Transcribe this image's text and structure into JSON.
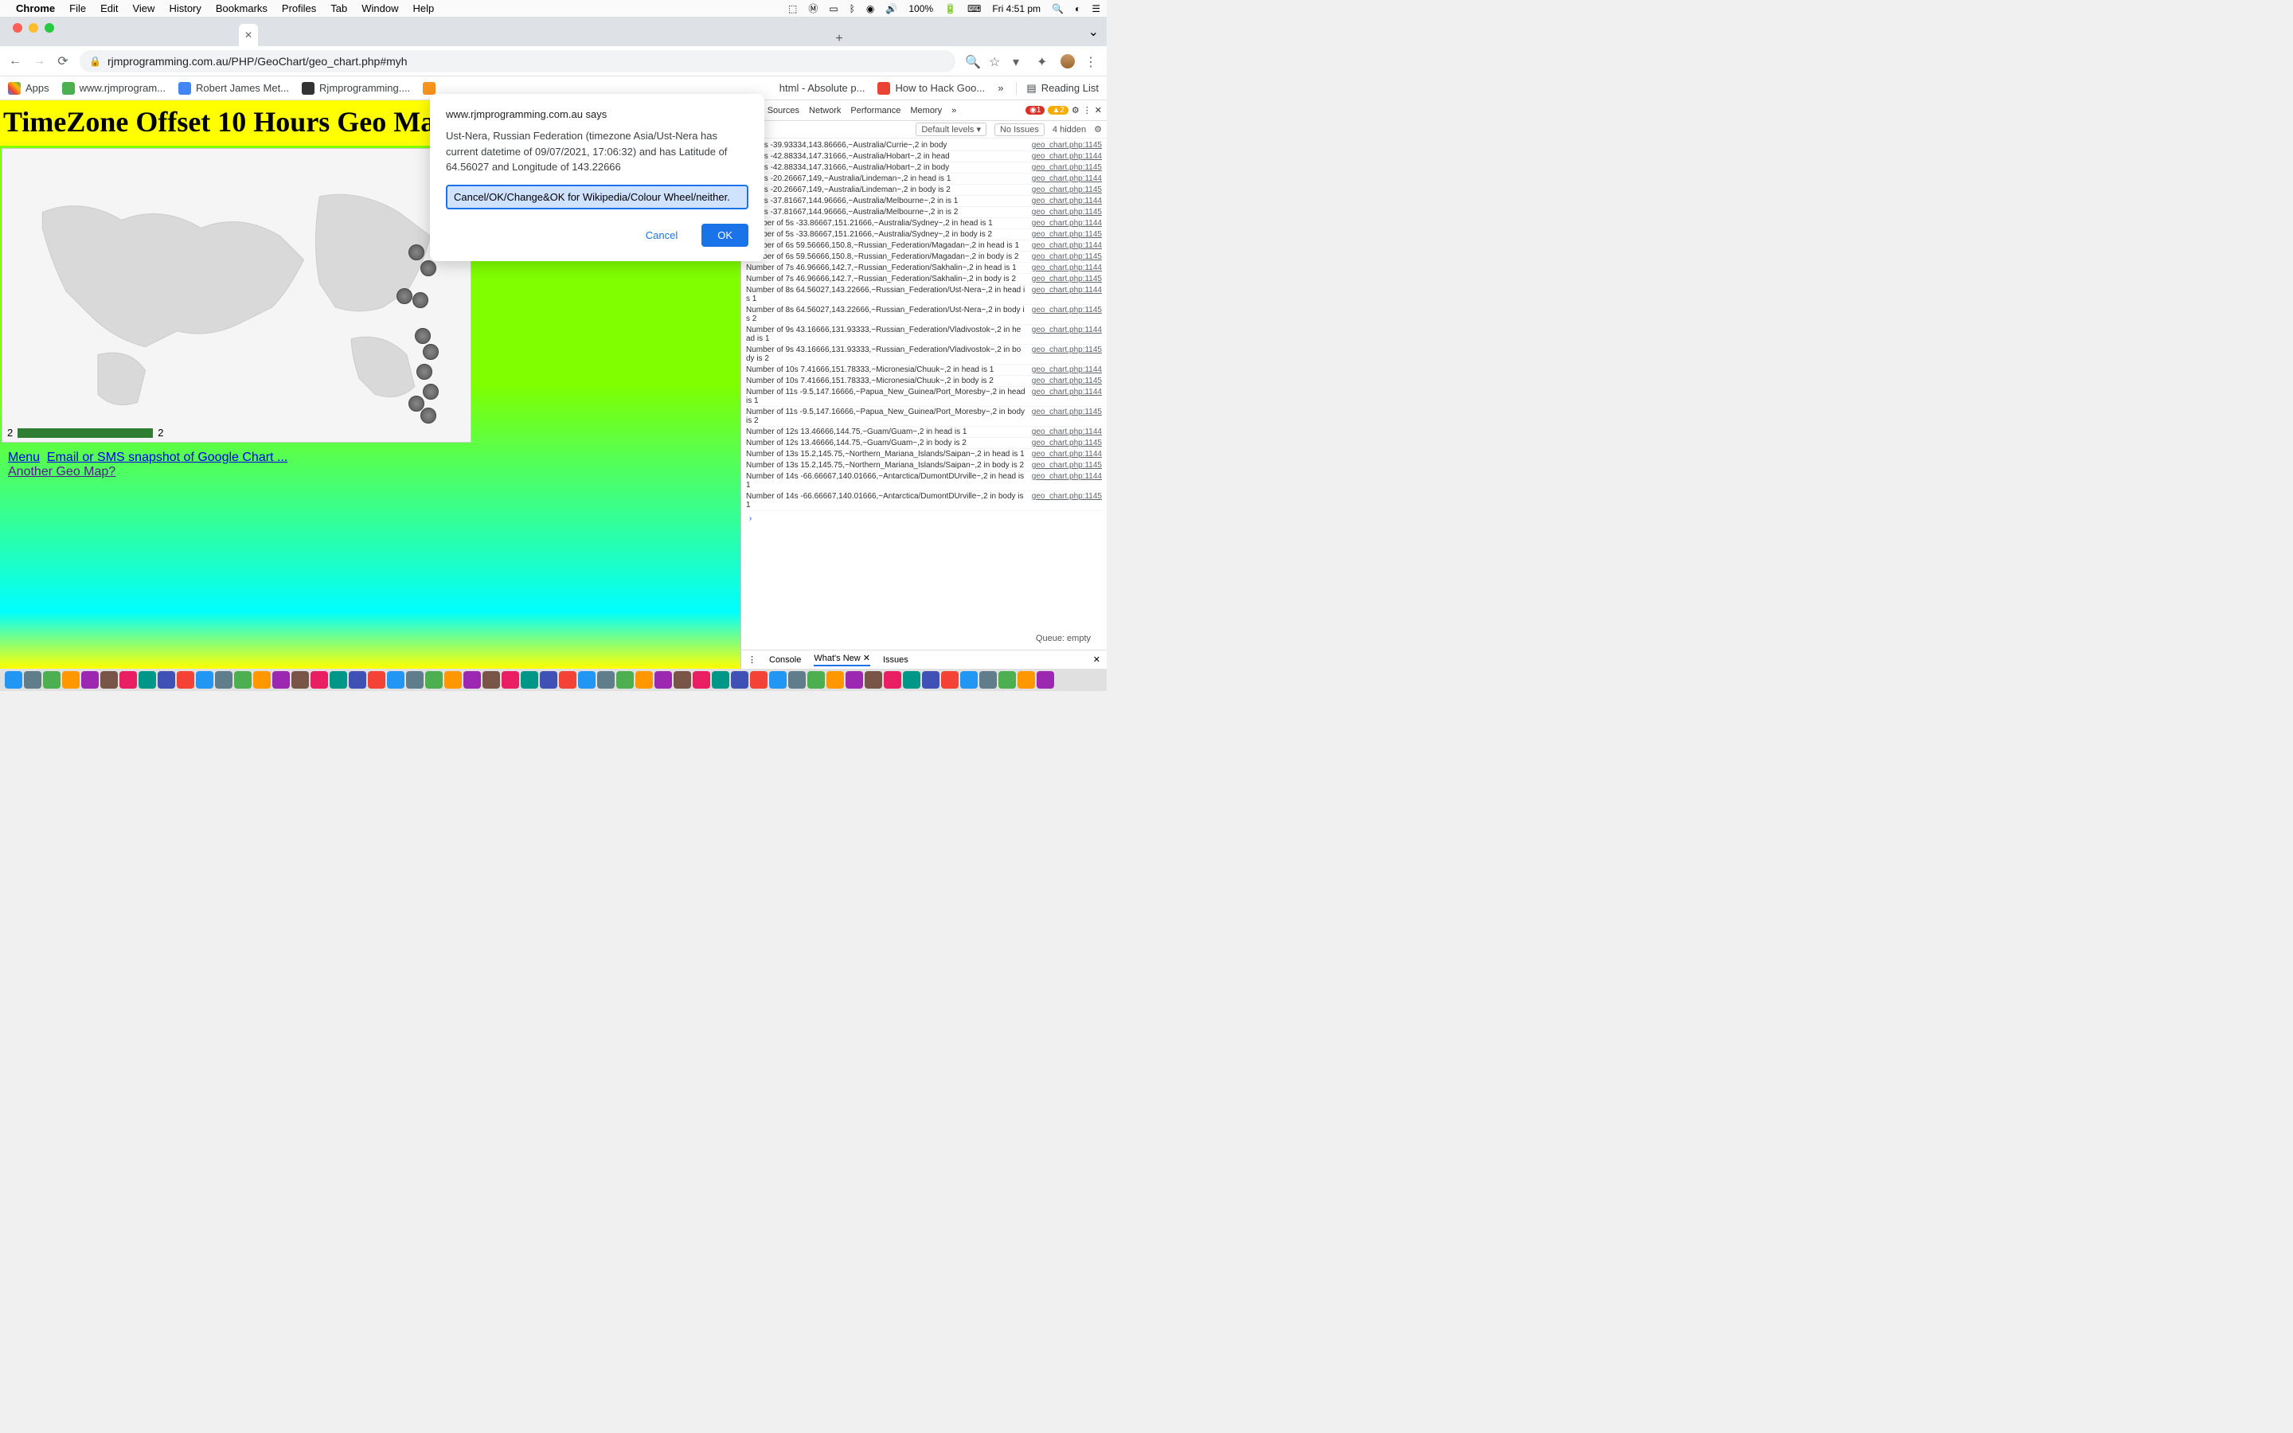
{
  "menubar": {
    "app": "Chrome",
    "items": [
      "File",
      "Edit",
      "View",
      "History",
      "Bookmarks",
      "Profiles",
      "Tab",
      "Window",
      "Help"
    ],
    "battery": "100%",
    "clock": "Fri 4:51 pm"
  },
  "browser": {
    "url": "rjmprogramming.com.au/PHP/GeoChart/geo_chart.php#myh",
    "newtab": "+",
    "bookmarks": {
      "apps": "Apps",
      "b1": "www.rjmprogram...",
      "b2": "Robert James Met...",
      "b3": "Rjmprogramming....",
      "right1": "html - Absolute p...",
      "right2": "How to Hack Goo...",
      "more": "»",
      "reading": "Reading List"
    }
  },
  "page": {
    "title": "TimeZone Offset 10 Hours Geo Map",
    "legend_min": "2",
    "legend_max": "2",
    "link_menu": "Menu",
    "link_email": "Email or SMS snapshot of Google Chart ...",
    "link_another": "Another Geo Map?"
  },
  "dialog": {
    "host": "www.rjmprogramming.com.au says",
    "message": "Ust-Nera, Russian Federation (timezone Asia/Ust-Nera has current datetime of 09/07/2021, 17:06:32) and has Latitude of 64.56027 and Longitude of 143.22666",
    "input": "Cancel/OK/Change&OK for Wikipedia/Colour Wheel/neither.",
    "cancel": "Cancel",
    "ok": "OK"
  },
  "devtools": {
    "tabs": [
      "ole",
      "Sources",
      "Network",
      "Performance",
      "Memory",
      "»"
    ],
    "err_count": "1",
    "warn_count": "2",
    "toolbar_levels": "Default levels ▾",
    "toolbar_issues": "No Issues",
    "toolbar_hidden": "4 hidden",
    "drawer": {
      "console": "Console",
      "whatsnew": "What's New",
      "issues": "Issues"
    },
    "rows": [
      {
        "msg": "r of 1s -39.93334,143.86666,~Australia/Currie~,2 in body",
        "src": "geo_chart.php:1145"
      },
      {
        "msg": "r of 2s -42.88334,147.31666,~Australia/Hobart~,2 in head",
        "src": "geo_chart.php:1144"
      },
      {
        "msg": "r of 2s -42.88334,147.31666,~Australia/Hobart~,2 in body",
        "src": "geo_chart.php:1145"
      },
      {
        "msg": "r of 3s -20.26667,149,~Australia/Lindeman~,2 in head is 1",
        "src": "geo_chart.php:1144"
      },
      {
        "msg": "r of 3s -20.26667,149,~Australia/Lindeman~,2 in body is 2",
        "src": "geo_chart.php:1145"
      },
      {
        "msg": "r of 4s -37.81667,144.96666,~Australia/Melbourne~,2 in is 1",
        "src": "geo_chart.php:1144"
      },
      {
        "msg": "r of 4s -37.81667,144.96666,~Australia/Melbourne~,2 in is 2",
        "src": "geo_chart.php:1145"
      },
      {
        "msg": "Number of 5s -33.86667,151.21666,~Australia/Sydney~,2 in head is 1",
        "src": "geo_chart.php:1144"
      },
      {
        "msg": "Number of 5s -33.86667,151.21666,~Australia/Sydney~,2 in body is 2",
        "src": "geo_chart.php:1145"
      },
      {
        "msg": "Number of 6s 59.56666,150.8,~Russian_Federation/Magadan~,2 in head is 1",
        "src": "geo_chart.php:1144"
      },
      {
        "msg": "Number of 6s 59.56666,150.8,~Russian_Federation/Magadan~,2 in body is 2",
        "src": "geo_chart.php:1145"
      },
      {
        "msg": "Number of 7s 46.96666,142.7,~Russian_Federation/Sakhalin~,2 in head is 1",
        "src": "geo_chart.php:1144"
      },
      {
        "msg": "Number of 7s 46.96666,142.7,~Russian_Federation/Sakhalin~,2 in body is 2",
        "src": "geo_chart.php:1145"
      },
      {
        "msg": "Number of 8s 64.56027,143.22666,~Russian_Federation/Ust-Nera~,2 in head is 1",
        "src": "geo_chart.php:1144"
      },
      {
        "msg": "Number of 8s 64.56027,143.22666,~Russian_Federation/Ust-Nera~,2 in body is 2",
        "src": "geo_chart.php:1145"
      },
      {
        "msg": "Number of 9s 43.16666,131.93333,~Russian_Federation/Vladivostok~,2 in head is 1",
        "src": "geo_chart.php:1144"
      },
      {
        "msg": "Number of 9s 43.16666,131.93333,~Russian_Federation/Vladivostok~,2 in body is 2",
        "src": "geo_chart.php:1145"
      },
      {
        "msg": "Number of 10s 7.41666,151.78333,~Micronesia/Chuuk~,2 in head is 1",
        "src": "geo_chart.php:1144"
      },
      {
        "msg": "Number of 10s 7.41666,151.78333,~Micronesia/Chuuk~,2 in body is 2",
        "src": "geo_chart.php:1145"
      },
      {
        "msg": "Number of 11s -9.5,147.16666,~Papua_New_Guinea/Port_Moresby~,2 in head is 1",
        "src": "geo_chart.php:1144"
      },
      {
        "msg": "Number of 11s -9.5,147.16666,~Papua_New_Guinea/Port_Moresby~,2 in body is 2",
        "src": "geo_chart.php:1145"
      },
      {
        "msg": "Number of 12s 13.46666,144.75,~Guam/Guam~,2 in head is 1",
        "src": "geo_chart.php:1144"
      },
      {
        "msg": "Number of 12s 13.46666,144.75,~Guam/Guam~,2 in body is 2",
        "src": "geo_chart.php:1145"
      },
      {
        "msg": "Number of 13s 15.2,145.75,~Northern_Mariana_Islands/Saipan~,2 in head is 1",
        "src": "geo_chart.php:1144"
      },
      {
        "msg": "Number of 13s 15.2,145.75,~Northern_Mariana_Islands/Saipan~,2 in body is 2",
        "src": "geo_chart.php:1145"
      },
      {
        "msg": "Number of 14s -66.66667,140.01666,~Antarctica/DumontDUrville~,2 in head is 1",
        "src": "geo_chart.php:1144"
      },
      {
        "msg": "Number of 14s -66.66667,140.01666,~Antarctica/DumontDUrville~,2 in body is 1",
        "src": "geo_chart.php:1145"
      }
    ],
    "prompt": "›"
  },
  "status": {
    "queue": "Queue: empty"
  }
}
